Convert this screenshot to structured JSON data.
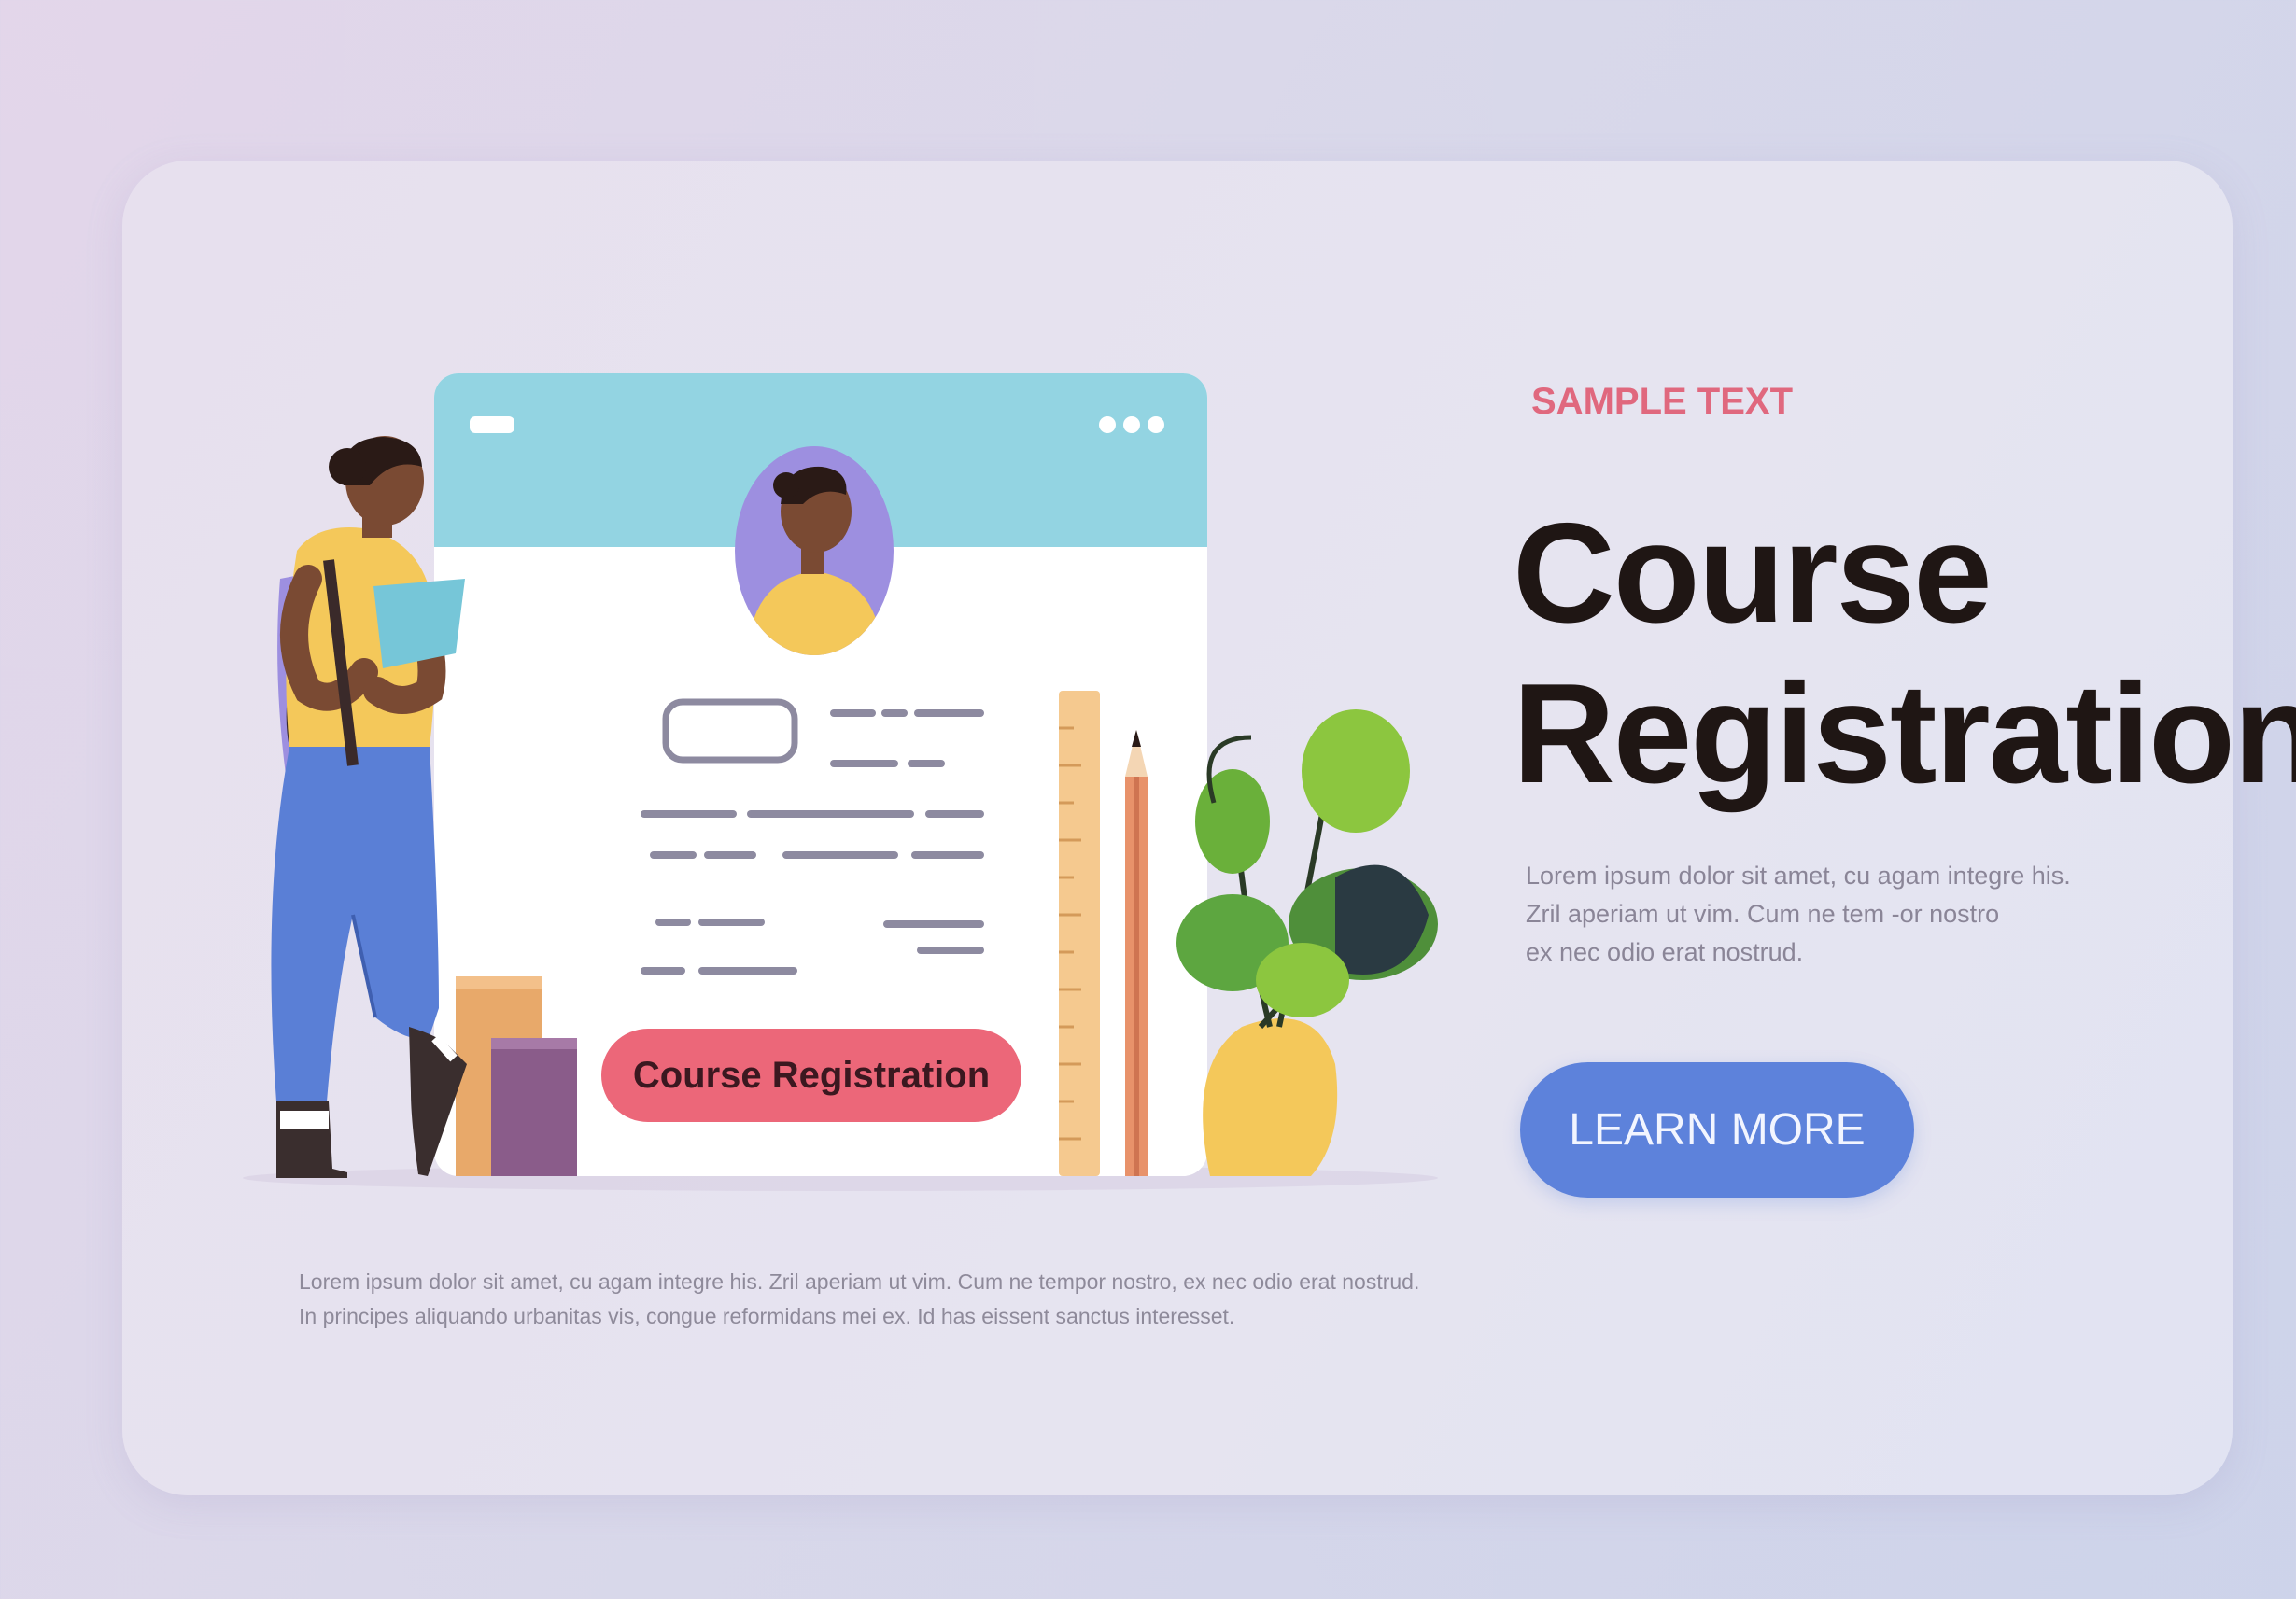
{
  "hero": {
    "eyebrow": "SAMPLE TEXT",
    "title_line1": "Course",
    "title_line2": "Registration",
    "body_line1": "Lorem ipsum dolor sit amet, cu agam integre his.",
    "body_line2": "Zril aperiam ut vim. Cum ne tem -or nostro",
    "body_line3": "ex nec odio erat nostrud.",
    "cta_label": "LEARN MORE"
  },
  "illustration": {
    "form_button_label": "Course Registration",
    "window_dots": "•••"
  },
  "footer": {
    "line1": "Lorem ipsum dolor sit amet, cu agam integre his. Zril aperiam ut vim. Cum ne tempor nostro, ex nec odio erat nostrud.",
    "line2": "In principes aliquando urbanitas vis, congue reformidans mei ex. Id has eissent sanctus interesset."
  },
  "colors": {
    "accent_pink": "#ec6779",
    "eyebrow_pink": "#e0687e",
    "cta_blue": "#5d82db",
    "headline": "#1f1614",
    "window_header": "#93d4e2"
  }
}
